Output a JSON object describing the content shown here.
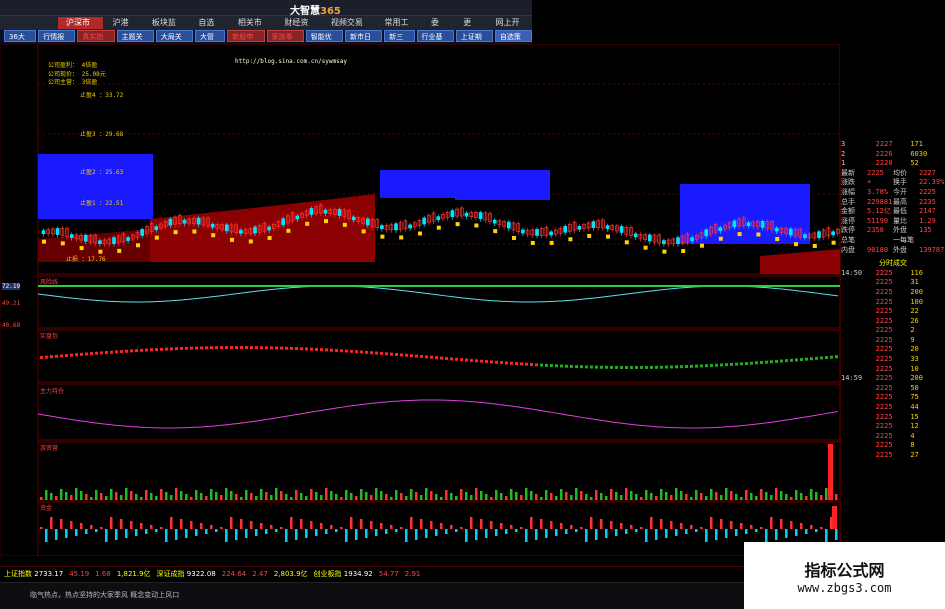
{
  "app": {
    "title_main": "大智慧",
    "title_suffix": "365"
  },
  "menu": [
    "沪深市场",
    "沪港通",
    "板块监控",
    "自选股",
    "相关市场",
    "财经资讯",
    "视频交易室",
    "常用工具",
    "委托",
    "更多",
    "网上开户"
  ],
  "tabs": [
    "36大水",
    "行情报价",
    "真实指标",
    "主题关注",
    "大局关注",
    "大管家",
    "新股申购",
    "家族事业",
    "智能优化",
    "新市日历",
    "新三板",
    "行业基金",
    "上证期权",
    "自选策略"
  ],
  "indicator_labels": {
    "main_hdr": "主图",
    "trend_note1": "公司盈利：",
    "trend_val1": "4倍盈",
    "trend_note2": "公司现价：",
    "trend_val2": "25.08元",
    "trend_note3": "公司主营：",
    "trend_val3": "3倍盈",
    "zhi1": "止盈4 ：33.72",
    "zhi2": "止盈3 ：29.68",
    "zhi3": "止盈2 ：25.63",
    "zhi4": "止盈1 ：22.51",
    "zhi5": "止损 ：17.76",
    "url": "http://blog.sina.com.cn/sywmsay",
    "sub1": "风险线",
    "sub2": "实盘包",
    "sub3": "主力持仓",
    "sub4": "游资营",
    "sub5": "资金",
    "val1": "72.19",
    "val2": "49.21",
    "val3": "40.68"
  },
  "right_panel": {
    "rows": [
      [
        "3",
        "2227",
        "171"
      ],
      [
        "2",
        "2226",
        "6030"
      ],
      [
        "1",
        "2220",
        "52"
      ],
      [
        "最新",
        "2225",
        "均价",
        "2227"
      ],
      [
        "涨跌",
        "+",
        "换手",
        "22.39%"
      ],
      [
        "涨幅",
        "3.78%",
        "今开",
        "2225"
      ],
      [
        "总手",
        "229881",
        "最高",
        "2235"
      ],
      [
        "金额",
        "5.12亿",
        "最低",
        "2147"
      ],
      [
        "涨停",
        "51190",
        "量比",
        "1.29"
      ],
      [
        "跌停",
        "2358",
        "外盘",
        "135"
      ],
      [
        "总笔",
        "",
        "一每笔",
        ""
      ],
      [
        "内盘",
        "90180",
        "外盘",
        "139787"
      ]
    ],
    "ticks_header": "分时成交",
    "ticks": [
      [
        "14:50",
        "2225",
        "116"
      ],
      [
        "",
        "2225",
        "31"
      ],
      [
        "",
        "2225",
        "200"
      ],
      [
        "",
        "2225",
        "100"
      ],
      [
        "",
        "2225",
        "22"
      ],
      [
        "",
        "2225",
        "26"
      ],
      [
        "",
        "2225",
        "2"
      ],
      [
        "",
        "2225",
        "9"
      ],
      [
        "",
        "2225",
        "20"
      ],
      [
        "",
        "2225",
        "33"
      ],
      [
        "",
        "2225",
        "10"
      ],
      [
        "14:59",
        "2225",
        "200"
      ],
      [
        "",
        "2225",
        "50"
      ],
      [
        "",
        "2225",
        "75"
      ],
      [
        "",
        "2225",
        "44"
      ],
      [
        "",
        "2225",
        "15"
      ],
      [
        "",
        "2225",
        "12"
      ],
      [
        "",
        "2225",
        "4"
      ],
      [
        "",
        "2225",
        "8"
      ],
      [
        "",
        "2225",
        "27"
      ]
    ]
  },
  "status": [
    {
      "label": "上证指数",
      "val": "2733.17"
    },
    {
      "label": "",
      "val": "45.19"
    },
    {
      "label": "",
      "val": "1.68"
    },
    {
      "label": "",
      "val": "1,821.9亿"
    },
    {
      "label": "深证成指",
      "val": "9322.08"
    },
    {
      "label": "",
      "val": "224.64"
    },
    {
      "label": "",
      "val": "2.47"
    },
    {
      "label": "",
      "val": "2,803.9亿"
    },
    {
      "label": "创业板指",
      "val": "1934.92"
    },
    {
      "label": "",
      "val": "54.77"
    },
    {
      "label": "",
      "val": "2.91"
    }
  ],
  "ticker": "临气热点，热点坚持的大家季风 概念变动上风口",
  "watermark": {
    "line1": "指标公式网",
    "line2": "www.zbgs3.com"
  }
}
